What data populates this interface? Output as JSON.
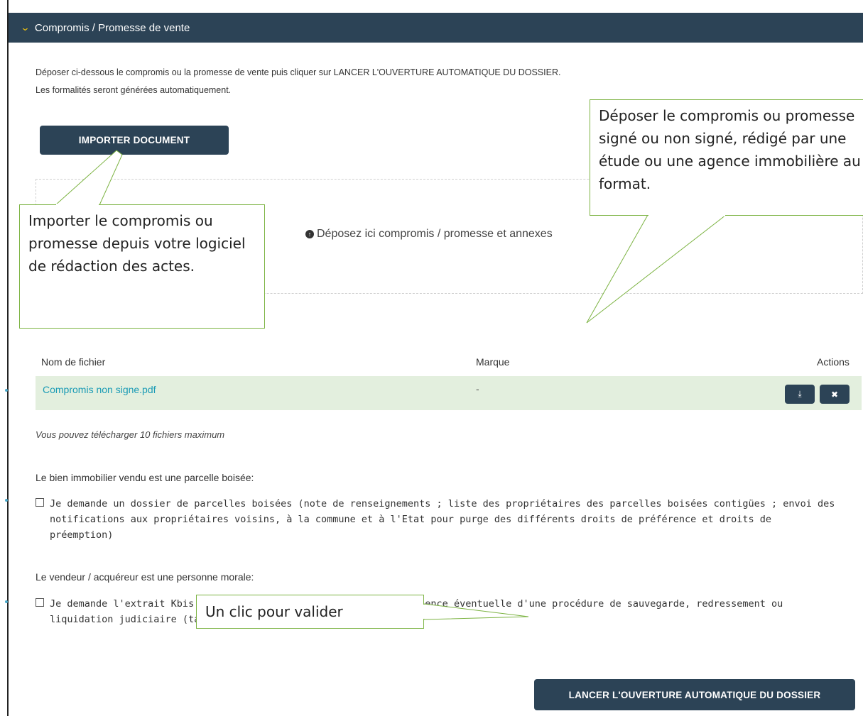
{
  "header": {
    "title": "Compromis / Promesse de vente"
  },
  "intro": {
    "line1": "Déposer ci-dessous le compromis ou la promesse de vente puis cliquer sur LANCER L'OUVERTURE AUTOMATIQUE DU DOSSIER.",
    "line2": "Les formalités seront générées automatiquement."
  },
  "import_button": {
    "label": "IMPORTER DOCUMENT"
  },
  "dropzone": {
    "text": "Déposez ici compromis / promesse et annexes"
  },
  "callouts": {
    "import": "Importer le compromis ou promesse depuis votre logiciel de rédaction des actes.",
    "deposit": "Déposer le compromis ou promesse signé ou non signé, rédigé par une étude ou une agence immobilière au format.",
    "validate": "Un clic pour valider"
  },
  "table": {
    "headers": {
      "filename": "Nom de fichier",
      "mark": "Marque",
      "actions": "Actions"
    },
    "rows": [
      {
        "filename": "Compromis non signe.pdf",
        "mark": "-"
      }
    ]
  },
  "note": "Vous pouvez télécharger 10 fichiers maximum",
  "section_wooded": {
    "label": "Le bien immobilier vendu est une parcelle boisée:",
    "checkbox": "Je demande un dossier de parcelles boisées (note de renseignements ; liste des propriétaires des parcelles boisées contigües ; envoi des notifications aux propriétaires voisins, à la commune et à l'Etat pour purge des différents droits de préférence et droits de préemption)"
  },
  "section_legal": {
    "label": "Le vendeur / acquéreur est une personne morale:",
    "checkbox": "Je demande l'extrait Kbis et les informations relatives à l'existence éventuelle d'une procédure de sauvegarde, redressement ou liquidation judiciaire (tarif en supplément : 9 € HT)"
  },
  "submit_button": {
    "label": "LANCER L'OUVERTURE AUTOMATIQUE DU DOSSIER"
  },
  "colors": {
    "header_bg": "#2c4356",
    "accent_yellow": "#f1c40f",
    "row_bg": "#e3efde",
    "link": "#1a9bb5",
    "callout_border": "#7cb342"
  }
}
